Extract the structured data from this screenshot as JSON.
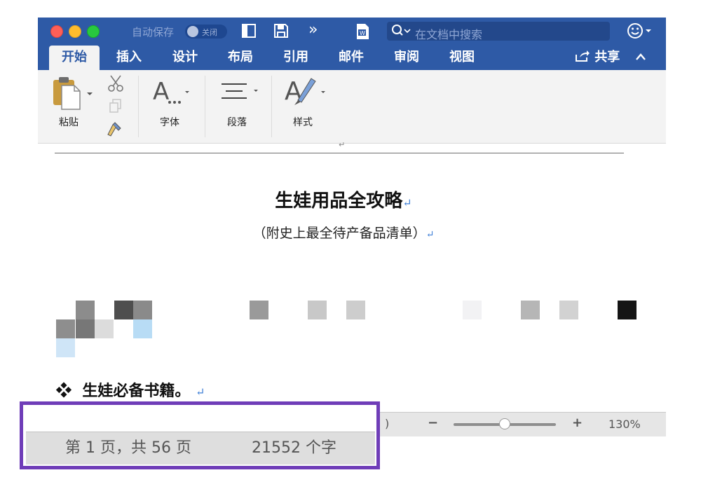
{
  "titlebar": {
    "autosave_label": "自动保存",
    "autosave_state": "关闭",
    "search_placeholder": "在文档中搜索",
    "icons": [
      "sidebar-icon",
      "save-icon",
      "more-icon",
      "word-doc-icon",
      "search-icon",
      "user-icon"
    ],
    "more_glyph": "»"
  },
  "tabs": [
    {
      "label": "开始",
      "active": true
    },
    {
      "label": "插入"
    },
    {
      "label": "设计"
    },
    {
      "label": "布局"
    },
    {
      "label": "引用"
    },
    {
      "label": "邮件"
    },
    {
      "label": "审阅"
    },
    {
      "label": "视图"
    }
  ],
  "share_label": "共享",
  "ribbon": {
    "paste_label": "粘贴",
    "font_label": "字体",
    "paragraph_label": "段落",
    "styles_label": "样式"
  },
  "document": {
    "title": "生娃用品全攻略",
    "subtitle": "（附史上最全待产备品清单）",
    "paragraph_mark": "↵",
    "bullet_symbol": "❖",
    "bullet_text": "生娃必备书籍。"
  },
  "statusbar": {
    "page_info": "第 1 页，共 56 页",
    "word_count": "21552 个字",
    "paren": ")",
    "zoom_minus": "−",
    "zoom_plus": "+",
    "zoom_level": "130%",
    "zoom_fraction": 0.5
  },
  "colors": {
    "accent": "#2e5aa6",
    "highlight": "#6f3db8",
    "paragraph_mark": "#3f7fd6"
  }
}
